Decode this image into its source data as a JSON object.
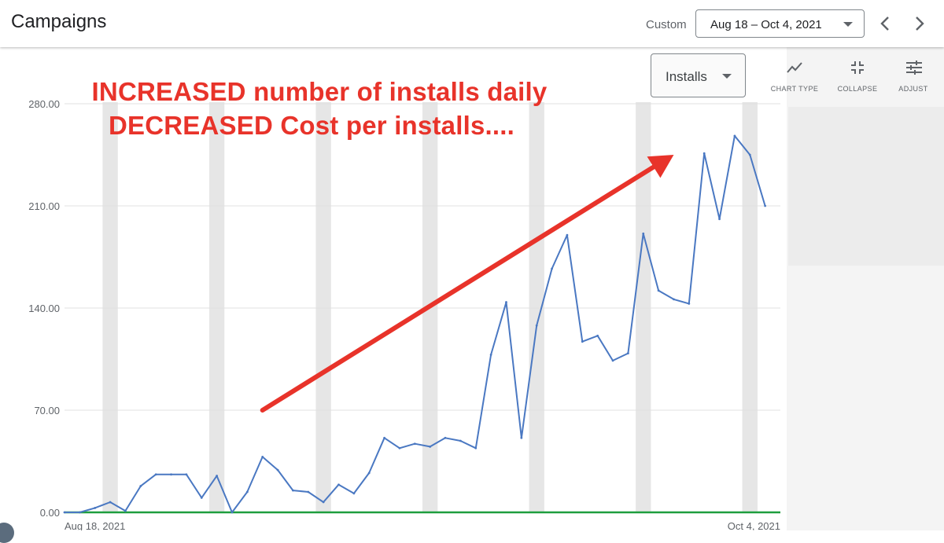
{
  "header": {
    "title": "Campaigns",
    "range_label": "Custom",
    "date_range": "Aug 18 – Oct 4, 2021",
    "prev_icon": "chevron-left-icon",
    "next_icon": "chevron-right-icon"
  },
  "toolbar": {
    "metric": "Installs",
    "chart_type_label": "CHART TYPE",
    "collapse_label": "COLLAPSE",
    "adjust_label": "ADJUST",
    "chart_type_icon": "line-chart-icon",
    "collapse_icon": "collapse-icon",
    "adjust_icon": "tune-icon"
  },
  "annotation": {
    "line1": "INCREASED number of installs daily",
    "line2": "DECREASED Cost per installs...."
  },
  "colors": {
    "series": "#4a78c2",
    "baseline": "#1e9e3e",
    "annotation": "#e8332a",
    "weekend_band": "#e6e6e6"
  },
  "chart_data": {
    "type": "line",
    "ylabel": "",
    "xlabel": "",
    "ylim": [
      0,
      280
    ],
    "y_ticks": [
      "0.00",
      "70.00",
      "140.00",
      "210.00",
      "280.00"
    ],
    "x_tick_labels": [
      "Aug 18, 2021",
      "Oct 4, 2021"
    ],
    "x": [
      "2021-08-18",
      "2021-08-19",
      "2021-08-20",
      "2021-08-21",
      "2021-08-22",
      "2021-08-23",
      "2021-08-24",
      "2021-08-25",
      "2021-08-26",
      "2021-08-27",
      "2021-08-28",
      "2021-08-29",
      "2021-08-30",
      "2021-08-31",
      "2021-09-01",
      "2021-09-02",
      "2021-09-03",
      "2021-09-04",
      "2021-09-05",
      "2021-09-06",
      "2021-09-07",
      "2021-09-08",
      "2021-09-09",
      "2021-09-10",
      "2021-09-11",
      "2021-09-12",
      "2021-09-13",
      "2021-09-14",
      "2021-09-15",
      "2021-09-16",
      "2021-09-17",
      "2021-09-18",
      "2021-09-19",
      "2021-09-20",
      "2021-09-21",
      "2021-09-22",
      "2021-09-23",
      "2021-09-24",
      "2021-09-25",
      "2021-09-26",
      "2021-09-27",
      "2021-09-28",
      "2021-09-29",
      "2021-09-30",
      "2021-10-01",
      "2021-10-02",
      "2021-10-03",
      "2021-10-04"
    ],
    "series": [
      {
        "values": [
          0,
          0,
          3,
          7,
          1,
          18,
          26,
          26,
          26,
          10,
          25,
          0,
          14,
          38,
          29,
          15,
          14,
          7,
          19,
          13,
          27,
          51,
          44,
          47,
          45,
          51,
          49,
          44,
          108,
          144,
          51,
          128,
          167,
          190,
          117,
          121,
          104,
          109,
          191,
          152,
          146,
          143,
          246,
          201,
          258,
          245,
          210
        ]
      }
    ],
    "baseline_values": [
      0,
      0
    ],
    "shaded_dates": [
      "2021-08-21",
      "2021-08-28",
      "2021-09-04",
      "2021-09-11",
      "2021-09-18",
      "2021-09-25",
      "2021-10-02"
    ],
    "annotation_arrow_values": [
      [
        13,
        70
      ],
      [
        40,
        245
      ]
    ],
    "grid": true
  }
}
